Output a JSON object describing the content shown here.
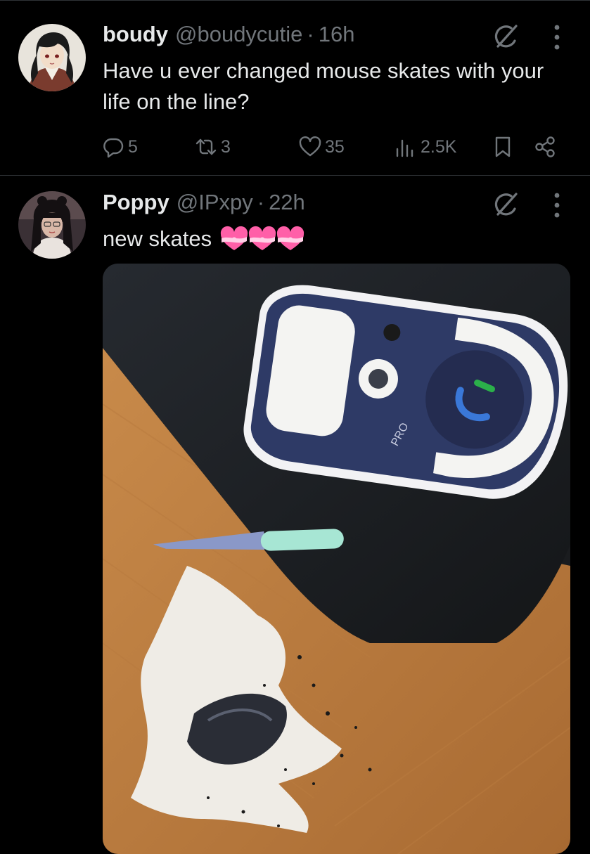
{
  "tweets": [
    {
      "name": "boudy",
      "handle": "@boudycutie",
      "separator": "·",
      "time": "16h",
      "text": "Have u ever changed mouse skates with your life on the line?",
      "avatar": "anime-character-avatar",
      "stats": {
        "replies": "5",
        "reposts": "3",
        "likes": "35",
        "views": "2.5K"
      }
    },
    {
      "name": "Poppy",
      "handle": "@IPxpy",
      "separator": "·",
      "time": "22h",
      "text": "new skates",
      "emoji": "heart-with-ribbon-emoji",
      "emoji_count": 3,
      "avatar": "profile-photo-avatar",
      "media": "photo-of-mouse-with-skates-and-nail-file"
    }
  ],
  "colors": {
    "background": "#000000",
    "primary_text": "#e7e9ea",
    "secondary_text": "#71767b",
    "divider": "#2f3336"
  },
  "icons": [
    "grok-icon",
    "more-icon",
    "reply-icon",
    "repost-icon",
    "like-icon",
    "views-icon",
    "bookmark-icon",
    "share-icon"
  ]
}
